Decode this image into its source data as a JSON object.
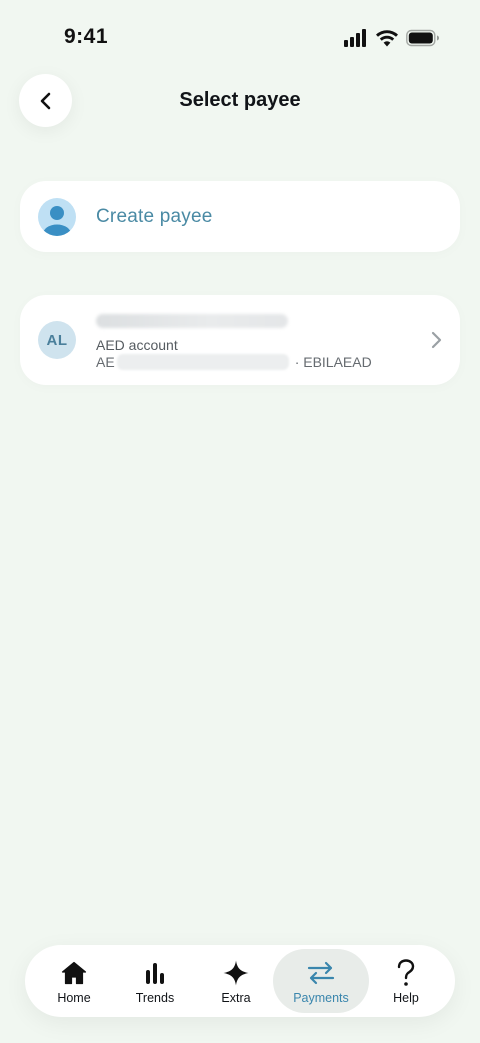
{
  "status_bar": {
    "time": "9:41"
  },
  "header": {
    "title": "Select payee"
  },
  "create_payee": {
    "label": "Create payee"
  },
  "payees": [
    {
      "initials": "AL",
      "account_type": "AED account",
      "iban_prefix": "AE",
      "bank_code": "· EBILAEAD"
    }
  ],
  "nav": {
    "items": [
      {
        "label": "Home",
        "icon": "home-icon"
      },
      {
        "label": "Trends",
        "icon": "bar-chart-icon"
      },
      {
        "label": "Extra",
        "icon": "sparkle-icon"
      },
      {
        "label": "Payments",
        "icon": "transfer-arrows-icon",
        "active": true
      },
      {
        "label": "Help",
        "icon": "question-mark-icon"
      }
    ]
  },
  "colors": {
    "background": "#f1f7f1",
    "accent": "#3a86ad",
    "create_label": "#4a8aa4",
    "avatar_bg": "#cfe3ee",
    "active_tab_bg": "#e8ece9"
  }
}
